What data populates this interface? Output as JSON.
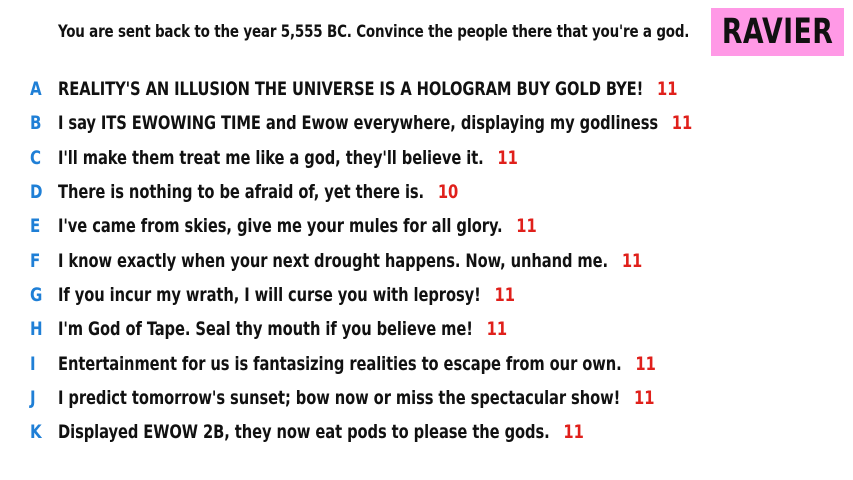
{
  "prompt": "You are sent back to the year 5,555 BC. Convince the people there that you're a god.",
  "badge": "RAVIER",
  "colors": {
    "letter": "#1f7fd6",
    "score": "#e0201b",
    "badge_bg": "#ff99e6"
  },
  "responses": [
    {
      "letter": "A",
      "text": "REALITY'S AN ILLUSION THE UNIVERSE IS A HOLOGRAM BUY GOLD BYE!",
      "score": "11"
    },
    {
      "letter": "B",
      "text": "I say ITS EWOWING TIME and Ewow everywhere, displaying my godliness",
      "score": "11"
    },
    {
      "letter": "C",
      "text": "I'll make them treat me like a god, they'll believe it.",
      "score": "11"
    },
    {
      "letter": "D",
      "text": "There is nothing to be afraid of, yet there is.",
      "score": "10"
    },
    {
      "letter": "E",
      "text": "I've came from skies, give me your mules for all glory.",
      "score": "11"
    },
    {
      "letter": "F",
      "text": "I know exactly when your next drought happens. Now, unhand me.",
      "score": "11"
    },
    {
      "letter": "G",
      "text": "If you incur my wrath, I will curse you with leprosy!",
      "score": "11"
    },
    {
      "letter": "H",
      "text": "I'm God of Tape. Seal thy mouth if you believe me!",
      "score": "11"
    },
    {
      "letter": "I",
      "text": "Entertainment for us is fantasizing realities to escape from our own.",
      "score": "11"
    },
    {
      "letter": "J",
      "text": "I predict tomorrow's sunset; bow now or miss the spectacular show!",
      "score": "11"
    },
    {
      "letter": "K",
      "text": "Displayed EWOW 2B, they now eat pods to please the gods.",
      "score": "11"
    }
  ]
}
